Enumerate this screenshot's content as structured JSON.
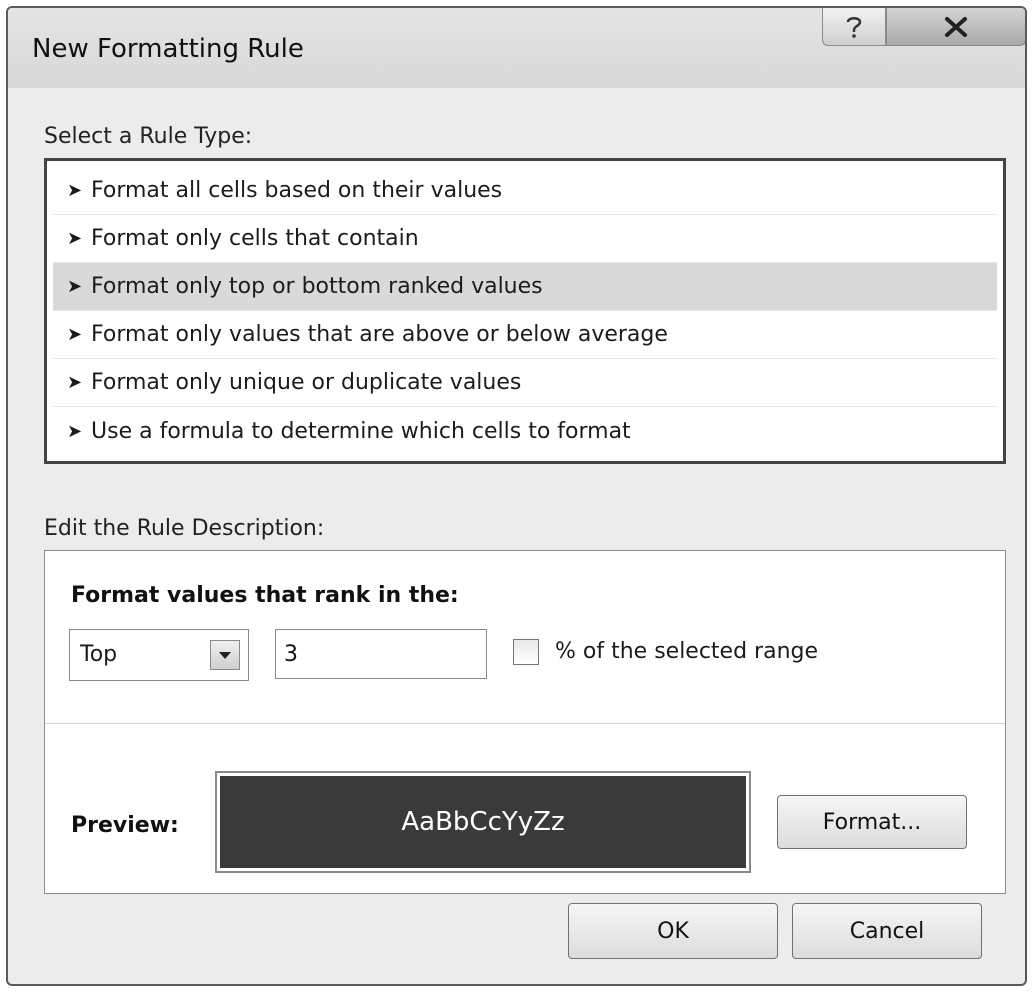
{
  "dialog": {
    "title": "New Formatting Rule"
  },
  "rule_type": {
    "label": "Select a Rule Type:",
    "items": [
      {
        "label": "Format all cells based on their values",
        "selected": false
      },
      {
        "label": "Format only cells that contain",
        "selected": false
      },
      {
        "label": "Format only top or bottom ranked values",
        "selected": true
      },
      {
        "label": "Format only values that are above or below average",
        "selected": false
      },
      {
        "label": "Format only unique or duplicate values",
        "selected": false
      },
      {
        "label": "Use a formula to determine which cells to format",
        "selected": false
      }
    ]
  },
  "rule_description": {
    "label": "Edit the Rule Description:",
    "rank_label": "Format values that rank in the:",
    "rank_direction": "Top",
    "rank_count": "3",
    "percent_checked": false,
    "percent_label": "% of the selected range",
    "preview_label": "Preview:",
    "preview_text": "AaBbCcYyZz",
    "format_button": "Format..."
  },
  "footer": {
    "ok_label": "OK",
    "cancel_label": "Cancel"
  },
  "colors": {
    "preview_fill": "#3a3a3a",
    "selected_row": "#d9d9d9"
  }
}
